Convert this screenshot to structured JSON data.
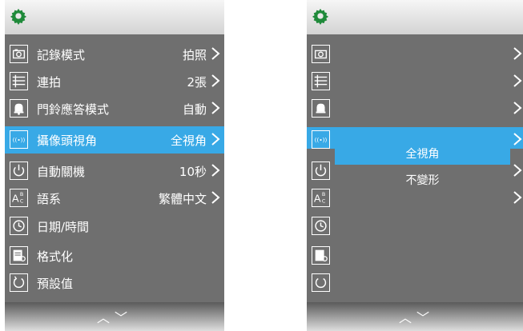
{
  "left_menu": {
    "items": [
      {
        "icon": "camera-icon",
        "label": "記錄模式",
        "value": "拍照",
        "has_chevron": true
      },
      {
        "icon": "burst-list-icon",
        "label": "連拍",
        "value": "2張",
        "has_chevron": true
      },
      {
        "icon": "bell-icon",
        "label": "門鈴應答模式",
        "value": "自動",
        "has_chevron": true
      },
      {
        "icon": "camera-view-icon",
        "label": "攝像頭視角",
        "value": "全視角",
        "has_chevron": true,
        "selected": true
      },
      {
        "icon": "power-icon",
        "label": "自動關機",
        "value": "10秒",
        "has_chevron": true
      },
      {
        "icon": "language-icon",
        "label": "語系",
        "value": "繁體中文",
        "has_chevron": true
      },
      {
        "icon": "clock-icon",
        "label": "日期/時間",
        "value": "",
        "has_chevron": false
      },
      {
        "icon": "format-icon",
        "label": "格式化",
        "value": "",
        "has_chevron": false
      },
      {
        "icon": "reset-icon",
        "label": "預設值",
        "value": "",
        "has_chevron": false
      }
    ]
  },
  "right_menu": {
    "popup": {
      "options": [
        "全視角",
        "不變形"
      ],
      "selected_index": 0
    }
  },
  "colors": {
    "panel_bg": "#6f6f6f",
    "highlight": "#38a9e6",
    "gear": "#1f8a3a"
  }
}
